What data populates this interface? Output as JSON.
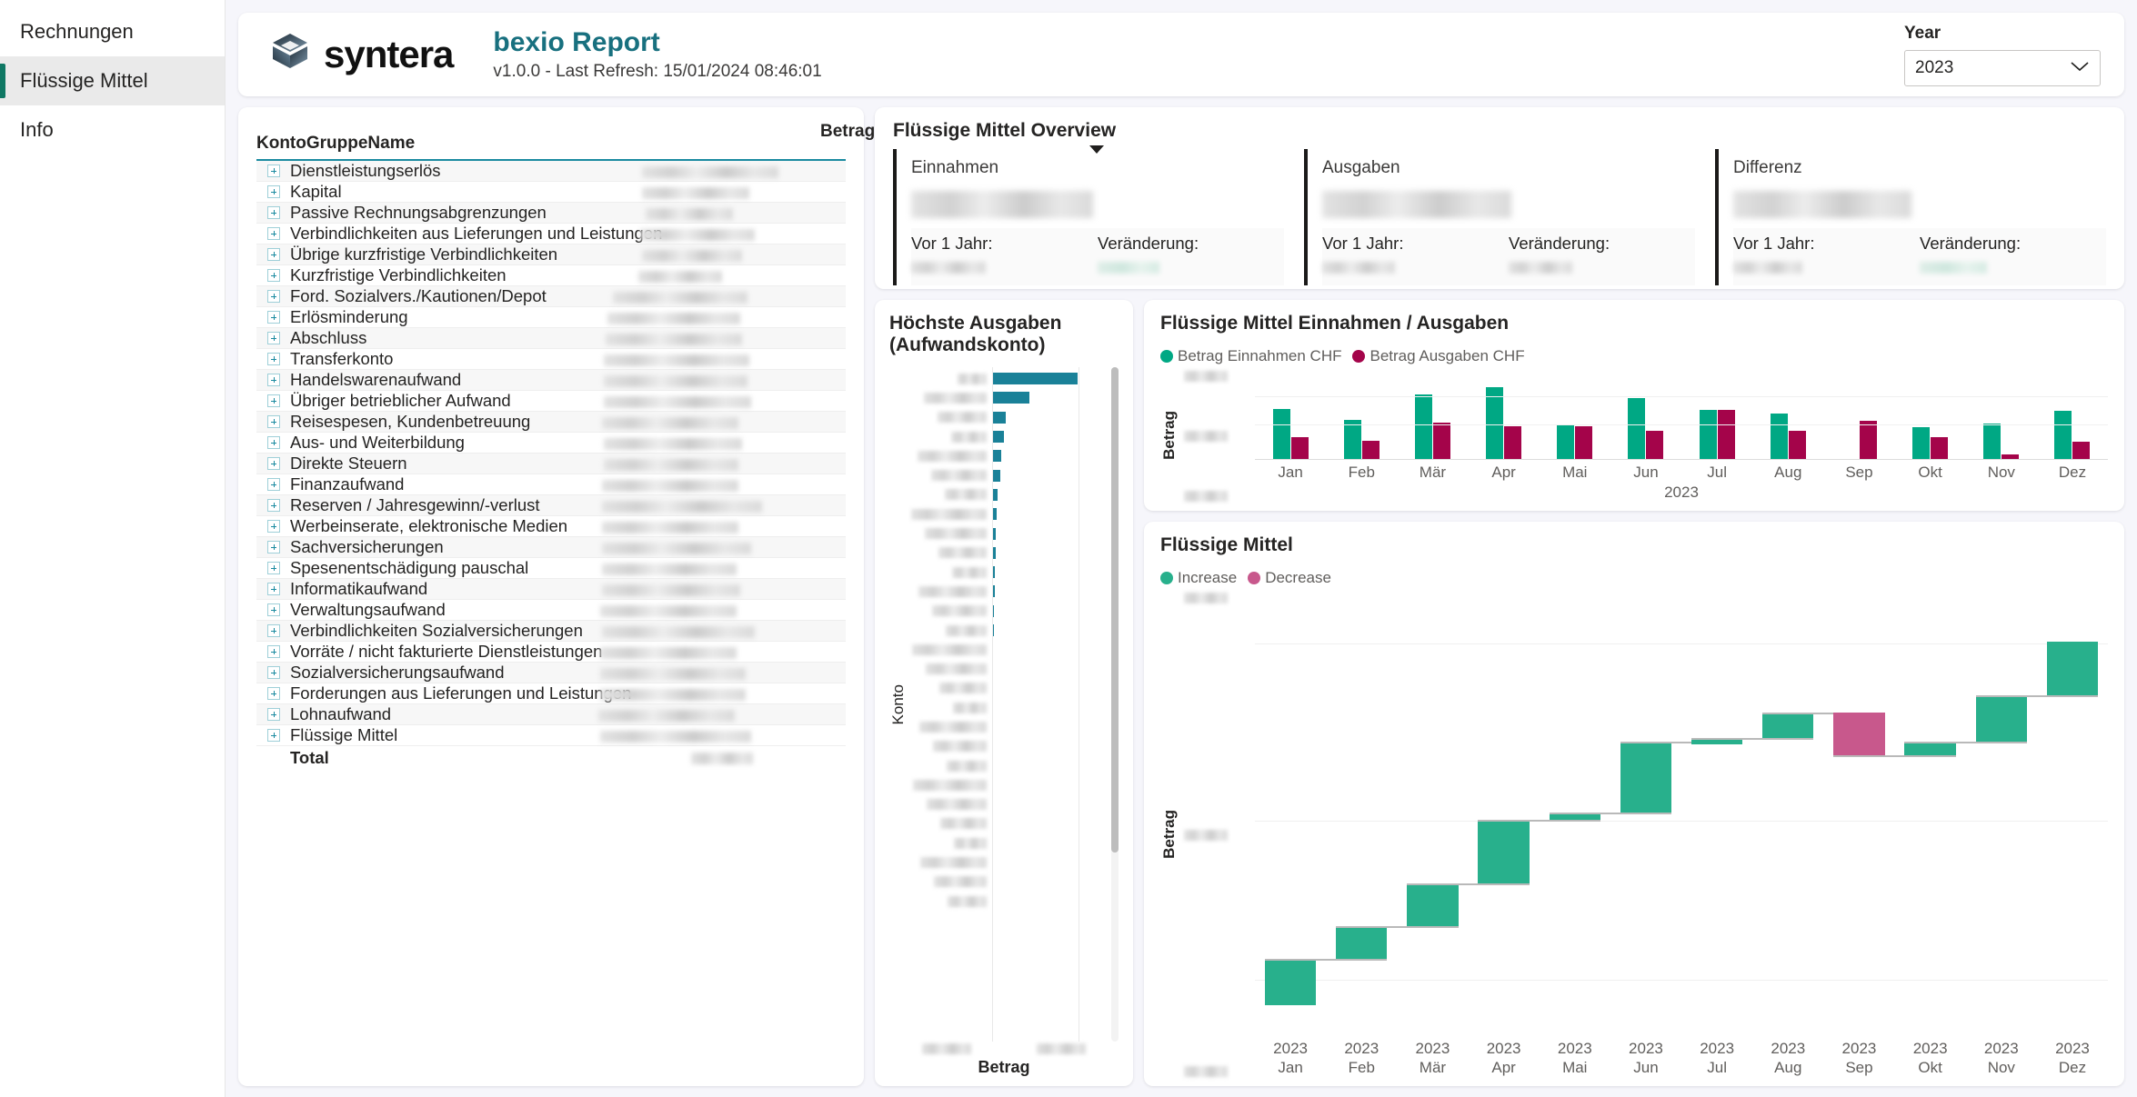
{
  "sidebar": {
    "items": [
      {
        "label": "Rechnungen",
        "active": false
      },
      {
        "label": "Flüssige Mittel",
        "active": true
      },
      {
        "label": "Info",
        "active": false
      }
    ]
  },
  "header": {
    "logo_text": "syntera",
    "title": "bexio Report",
    "subtitle": "v1.0.0 - Last Refresh: 15/01/2024 08:46:01",
    "year_label": "Year",
    "year_value": "2023",
    "year_options": [
      "2023"
    ],
    "accent_color": "#18707f"
  },
  "table": {
    "columns": [
      "KontoGruppeName",
      "Betrag"
    ],
    "sort_column": "Betrag",
    "sort_direction": "descending",
    "total_label": "Total",
    "rows": [
      "Dienstleistungserlös",
      "Kapital",
      "Passive Rechnungsabgrenzungen",
      "Verbindlichkeiten aus Lieferungen und Leistungen",
      "Übrige kurzfristige Verbindlichkeiten",
      "Kurzfristige Verbindlichkeiten",
      "Ford. Sozialvers./Kautionen/Depot",
      "Erlösminderung",
      "Abschluss",
      "Transferkonto",
      "Handelswarenaufwand",
      "Übriger betrieblicher Aufwand",
      "Reisespesen, Kundenbetreuung",
      "Aus- und Weiterbildung",
      "Direkte Steuern",
      "Finanzaufwand",
      "Reserven / Jahresgewinn/-verlust",
      "Werbeinserate, elektronische Medien",
      "Sachversicherungen",
      "Spesenentschädigung pauschal",
      "Informatikaufwand",
      "Verwaltungsaufwand",
      "Verbindlichkeiten Sozialversicherungen",
      "Vorräte / nicht fakturierte Dienstleistungen",
      "Sozialversicherungsaufwand",
      "Forderungen aus Lieferungen und Leistungen",
      "Lohnaufwand",
      "Flüssige Mittel"
    ]
  },
  "overview": {
    "title": "Flüssige Mittel Overview",
    "prev_year_label": "Vor 1 Jahr:",
    "change_label": "Veränderung:",
    "kpis": [
      {
        "label": "Einnahmen"
      },
      {
        "label": "Ausgaben"
      },
      {
        "label": "Differenz"
      }
    ]
  },
  "expenses_chart": {
    "title": "Höchste Ausgaben (Aufwandskonto)",
    "ylabel": "Konto",
    "xlabel": "Betrag"
  },
  "monthly_chart": {
    "title": "Flüssige Mittel Einnahmen / Ausgaben",
    "legend": [
      {
        "label": "Betrag Einnahmen CHF",
        "color": "#00a884"
      },
      {
        "label": "Betrag Ausgaben CHF",
        "color": "#a4044a"
      }
    ]
  },
  "waterfall_chart": {
    "title": "Flüssige Mittel",
    "legend": [
      {
        "label": "Increase",
        "color": "#28b08c"
      },
      {
        "label": "Decrease",
        "color": "#c8588c"
      }
    ]
  },
  "chart_data": [
    {
      "type": "bar",
      "orientation": "horizontal",
      "title": "Höchste Ausgaben (Aufwandskonto)",
      "xlabel": "Betrag",
      "ylabel": "Konto",
      "categories_redacted": true,
      "values": [
        100,
        44,
        17,
        15,
        12,
        11,
        7,
        6,
        5.5,
        5,
        4.5,
        4,
        3.5,
        3,
        2.5,
        2,
        1.6,
        1.2,
        1,
        0.8,
        0.6,
        0.5,
        0.4,
        0.3,
        0.25,
        0.2,
        0.15,
        0.1
      ],
      "grid": true,
      "color": "#1a8198"
    },
    {
      "type": "bar",
      "orientation": "vertical",
      "title": "Flüssige Mittel Einnahmen / Ausgaben",
      "xlabel": "2023",
      "ylabel": "Betrag",
      "categories": [
        "Jan",
        "Feb",
        "Mär",
        "Apr",
        "Mai",
        "Jun",
        "Jul",
        "Aug",
        "Sep",
        "Okt",
        "Nov",
        "Dez"
      ],
      "series": [
        {
          "name": "Betrag Einnahmen CHF",
          "color": "#00a884",
          "values": [
            58,
            45,
            74,
            83,
            40,
            70,
            57,
            52,
            0,
            37,
            41,
            56
          ]
        },
        {
          "name": "Betrag Ausgaben CHF",
          "color": "#a4044a",
          "values": [
            25,
            21,
            42,
            38,
            38,
            32,
            57,
            33,
            44,
            25,
            5,
            20
          ]
        }
      ],
      "ytick_labels_redacted": true,
      "grid": true,
      "legend_position": "top"
    },
    {
      "type": "bar",
      "subtype": "waterfall",
      "title": "Flüssige Mittel",
      "ylabel": "Betrag",
      "categories": [
        "2023 Jan",
        "2023 Feb",
        "2023 Mär",
        "2023 Apr",
        "2023 Mai",
        "2023 Jun",
        "2023 Jul",
        "2023 Aug",
        "2023 Sep",
        "2023 Okt",
        "2023 Nov",
        "2023 Dez"
      ],
      "category_year": "2023",
      "category_months": [
        "Jan",
        "Feb",
        "Mär",
        "Apr",
        "Mai",
        "Jun",
        "Jul",
        "Aug",
        "Sep",
        "Okt",
        "Nov",
        "Dez"
      ],
      "deltas": [
        13,
        9,
        12,
        18,
        2,
        20,
        1,
        7,
        -12,
        4,
        13,
        15
      ],
      "directions": [
        "Increase",
        "Increase",
        "Increase",
        "Increase",
        "Increase",
        "Increase",
        "Increase",
        "Increase",
        "Decrease",
        "Increase",
        "Increase",
        "Increase"
      ],
      "ytick_labels_redacted": true,
      "grid": true,
      "legend_position": "top"
    }
  ]
}
